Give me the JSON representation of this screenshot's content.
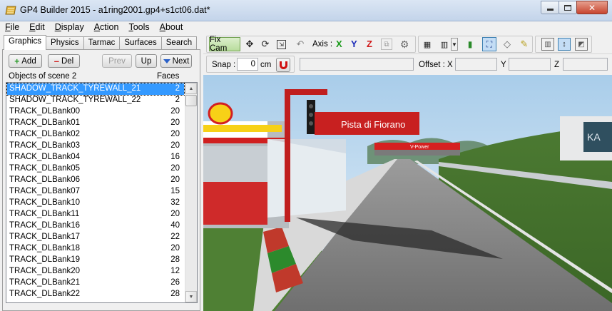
{
  "window": {
    "title": "GP4 Builder 2015 - a1ring2001.gp4+s1ct06.dat*"
  },
  "menu": [
    "File",
    "Edit",
    "Display",
    "Action",
    "Tools",
    "About"
  ],
  "tabs": [
    "Graphics",
    "Physics",
    "Tarmac",
    "Surfaces",
    "Search"
  ],
  "active_tab": "Graphics",
  "buttons": {
    "add": "Add",
    "del": "Del",
    "prev": "Prev",
    "up": "Up",
    "next": "Next"
  },
  "list": {
    "col_objects": "Objects of scene 2",
    "col_faces": "Faces",
    "rows": [
      {
        "name": "SHADOW_TRACK_TYREWALL_21",
        "faces": "2"
      },
      {
        "name": "SHADOW_TRACK_TYREWALL_22",
        "faces": "2"
      },
      {
        "name": "TRACK_DLBank00",
        "faces": "20"
      },
      {
        "name": "TRACK_DLBank01",
        "faces": "20"
      },
      {
        "name": "TRACK_DLBank02",
        "faces": "20"
      },
      {
        "name": "TRACK_DLBank03",
        "faces": "20"
      },
      {
        "name": "TRACK_DLBank04",
        "faces": "16"
      },
      {
        "name": "TRACK_DLBank05",
        "faces": "20"
      },
      {
        "name": "TRACK_DLBank06",
        "faces": "20"
      },
      {
        "name": "TRACK_DLBank07",
        "faces": "15"
      },
      {
        "name": "TRACK_DLBank10",
        "faces": "32"
      },
      {
        "name": "TRACK_DLBank11",
        "faces": "20"
      },
      {
        "name": "TRACK_DLBank16",
        "faces": "40"
      },
      {
        "name": "TRACK_DLBank17",
        "faces": "22"
      },
      {
        "name": "TRACK_DLBank18",
        "faces": "20"
      },
      {
        "name": "TRACK_DLBank19",
        "faces": "28"
      },
      {
        "name": "TRACK_DLBank20",
        "faces": "12"
      },
      {
        "name": "TRACK_DLBank21",
        "faces": "26"
      },
      {
        "name": "TRACK_DLBank22",
        "faces": "28"
      }
    ],
    "selected_index": 0
  },
  "toolbar": {
    "fix_cam": "Fix Cam",
    "axis_label": "Axis :",
    "axes": [
      "X",
      "Y",
      "Z"
    ],
    "axis_colors": {
      "X": "#1a9a1a",
      "Y": "#1a2ab8",
      "Z": "#d01818"
    }
  },
  "snap": {
    "label": "Snap :",
    "value": "0",
    "unit": "cm"
  },
  "offset": {
    "label": "Offset : X",
    "y_label": "Y",
    "z_label": "Z"
  },
  "scene": {
    "sign_main": "Pista di Fiorano",
    "sign_bridge": "V-Power",
    "sign_right": "KA"
  }
}
